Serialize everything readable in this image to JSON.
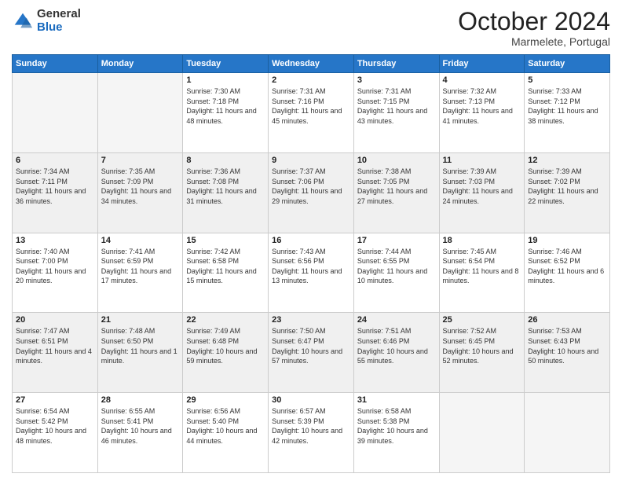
{
  "header": {
    "logo_general": "General",
    "logo_blue": "Blue",
    "month_title": "October 2024",
    "subtitle": "Marmelete, Portugal"
  },
  "days_of_week": [
    "Sunday",
    "Monday",
    "Tuesday",
    "Wednesday",
    "Thursday",
    "Friday",
    "Saturday"
  ],
  "weeks": [
    [
      {
        "day": "",
        "info": ""
      },
      {
        "day": "",
        "info": ""
      },
      {
        "day": "1",
        "info": "Sunrise: 7:30 AM\nSunset: 7:18 PM\nDaylight: 11 hours and 48 minutes."
      },
      {
        "day": "2",
        "info": "Sunrise: 7:31 AM\nSunset: 7:16 PM\nDaylight: 11 hours and 45 minutes."
      },
      {
        "day": "3",
        "info": "Sunrise: 7:31 AM\nSunset: 7:15 PM\nDaylight: 11 hours and 43 minutes."
      },
      {
        "day": "4",
        "info": "Sunrise: 7:32 AM\nSunset: 7:13 PM\nDaylight: 11 hours and 41 minutes."
      },
      {
        "day": "5",
        "info": "Sunrise: 7:33 AM\nSunset: 7:12 PM\nDaylight: 11 hours and 38 minutes."
      }
    ],
    [
      {
        "day": "6",
        "info": "Sunrise: 7:34 AM\nSunset: 7:11 PM\nDaylight: 11 hours and 36 minutes."
      },
      {
        "day": "7",
        "info": "Sunrise: 7:35 AM\nSunset: 7:09 PM\nDaylight: 11 hours and 34 minutes."
      },
      {
        "day": "8",
        "info": "Sunrise: 7:36 AM\nSunset: 7:08 PM\nDaylight: 11 hours and 31 minutes."
      },
      {
        "day": "9",
        "info": "Sunrise: 7:37 AM\nSunset: 7:06 PM\nDaylight: 11 hours and 29 minutes."
      },
      {
        "day": "10",
        "info": "Sunrise: 7:38 AM\nSunset: 7:05 PM\nDaylight: 11 hours and 27 minutes."
      },
      {
        "day": "11",
        "info": "Sunrise: 7:39 AM\nSunset: 7:03 PM\nDaylight: 11 hours and 24 minutes."
      },
      {
        "day": "12",
        "info": "Sunrise: 7:39 AM\nSunset: 7:02 PM\nDaylight: 11 hours and 22 minutes."
      }
    ],
    [
      {
        "day": "13",
        "info": "Sunrise: 7:40 AM\nSunset: 7:00 PM\nDaylight: 11 hours and 20 minutes."
      },
      {
        "day": "14",
        "info": "Sunrise: 7:41 AM\nSunset: 6:59 PM\nDaylight: 11 hours and 17 minutes."
      },
      {
        "day": "15",
        "info": "Sunrise: 7:42 AM\nSunset: 6:58 PM\nDaylight: 11 hours and 15 minutes."
      },
      {
        "day": "16",
        "info": "Sunrise: 7:43 AM\nSunset: 6:56 PM\nDaylight: 11 hours and 13 minutes."
      },
      {
        "day": "17",
        "info": "Sunrise: 7:44 AM\nSunset: 6:55 PM\nDaylight: 11 hours and 10 minutes."
      },
      {
        "day": "18",
        "info": "Sunrise: 7:45 AM\nSunset: 6:54 PM\nDaylight: 11 hours and 8 minutes."
      },
      {
        "day": "19",
        "info": "Sunrise: 7:46 AM\nSunset: 6:52 PM\nDaylight: 11 hours and 6 minutes."
      }
    ],
    [
      {
        "day": "20",
        "info": "Sunrise: 7:47 AM\nSunset: 6:51 PM\nDaylight: 11 hours and 4 minutes."
      },
      {
        "day": "21",
        "info": "Sunrise: 7:48 AM\nSunset: 6:50 PM\nDaylight: 11 hours and 1 minute."
      },
      {
        "day": "22",
        "info": "Sunrise: 7:49 AM\nSunset: 6:48 PM\nDaylight: 10 hours and 59 minutes."
      },
      {
        "day": "23",
        "info": "Sunrise: 7:50 AM\nSunset: 6:47 PM\nDaylight: 10 hours and 57 minutes."
      },
      {
        "day": "24",
        "info": "Sunrise: 7:51 AM\nSunset: 6:46 PM\nDaylight: 10 hours and 55 minutes."
      },
      {
        "day": "25",
        "info": "Sunrise: 7:52 AM\nSunset: 6:45 PM\nDaylight: 10 hours and 52 minutes."
      },
      {
        "day": "26",
        "info": "Sunrise: 7:53 AM\nSunset: 6:43 PM\nDaylight: 10 hours and 50 minutes."
      }
    ],
    [
      {
        "day": "27",
        "info": "Sunrise: 6:54 AM\nSunset: 5:42 PM\nDaylight: 10 hours and 48 minutes."
      },
      {
        "day": "28",
        "info": "Sunrise: 6:55 AM\nSunset: 5:41 PM\nDaylight: 10 hours and 46 minutes."
      },
      {
        "day": "29",
        "info": "Sunrise: 6:56 AM\nSunset: 5:40 PM\nDaylight: 10 hours and 44 minutes."
      },
      {
        "day": "30",
        "info": "Sunrise: 6:57 AM\nSunset: 5:39 PM\nDaylight: 10 hours and 42 minutes."
      },
      {
        "day": "31",
        "info": "Sunrise: 6:58 AM\nSunset: 5:38 PM\nDaylight: 10 hours and 39 minutes."
      },
      {
        "day": "",
        "info": ""
      },
      {
        "day": "",
        "info": ""
      }
    ]
  ]
}
